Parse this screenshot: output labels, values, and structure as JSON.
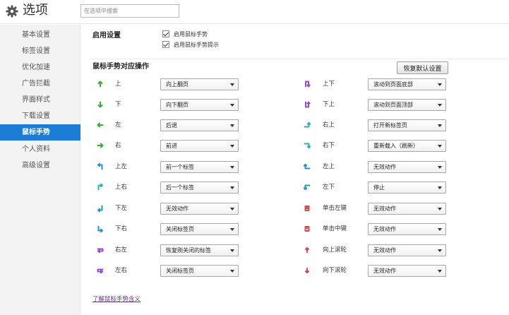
{
  "header": {
    "title": "选项",
    "search_placeholder": "在选项中搜索"
  },
  "sidebar": {
    "items": [
      {
        "label": "基本设置",
        "active": false
      },
      {
        "label": "标签设置",
        "active": false
      },
      {
        "label": "优化加速",
        "active": false
      },
      {
        "label": "广告拦截",
        "active": false
      },
      {
        "label": "界面样式",
        "active": false
      },
      {
        "label": "下载设置",
        "active": false
      },
      {
        "label": "鼠标手势",
        "active": true
      },
      {
        "label": "个人资料",
        "active": false
      },
      {
        "label": "高级设置",
        "active": false
      }
    ]
  },
  "enable": {
    "title": "启用设置",
    "options": [
      {
        "label": "启用鼠标手势",
        "checked": true
      },
      {
        "label": "启用鼠标手势提示",
        "checked": true
      }
    ]
  },
  "gestures": {
    "title": "鼠标手势对应操作",
    "reset_label": "恢复默认设置",
    "left": [
      {
        "label": "上",
        "action": "向上翻页",
        "icon": "arrow-up-icon",
        "color": "#3aaa3a"
      },
      {
        "label": "下",
        "action": "向下翻页",
        "icon": "arrow-down-icon",
        "color": "#3aaa3a"
      },
      {
        "label": "左",
        "action": "后退",
        "icon": "arrow-left-icon",
        "color": "#3aaa3a"
      },
      {
        "label": "右",
        "action": "前进",
        "icon": "arrow-right-icon",
        "color": "#3aaa3a"
      },
      {
        "label": "上左",
        "action": "前一个标签",
        "icon": "up-left-icon",
        "color": "#2c8fc8"
      },
      {
        "label": "上右",
        "action": "后一个标签",
        "icon": "up-right-icon",
        "color": "#2cb0b0"
      },
      {
        "label": "下左",
        "action": "无效动作",
        "icon": "down-left-icon",
        "color": "#2c8fc8"
      },
      {
        "label": "下右",
        "action": "关闭标签页",
        "icon": "down-right-icon",
        "color": "#2c8fc8"
      },
      {
        "label": "右左",
        "action": "恢复刚关闭的标签",
        "icon": "right-left-icon",
        "color": "#9a4cc6"
      },
      {
        "label": "左右",
        "action": "关闭标签页",
        "icon": "left-right-icon",
        "color": "#9a4cc6"
      }
    ],
    "right": [
      {
        "label": "上下",
        "action": "滚动到页面底部",
        "icon": "up-down-icon",
        "color": "#9a4cc6"
      },
      {
        "label": "下上",
        "action": "滚动到页面顶部",
        "icon": "down-up-icon",
        "color": "#9a4cc6"
      },
      {
        "label": "右上",
        "action": "打开新标签页",
        "icon": "right-up-icon",
        "color": "#2cb0b0"
      },
      {
        "label": "右下",
        "action": "重新载入（刷新）",
        "icon": "right-down-icon",
        "color": "#2cb0b0"
      },
      {
        "label": "左上",
        "action": "无效动作",
        "icon": "left-up-icon",
        "color": "#2c8fc8"
      },
      {
        "label": "左下",
        "action": "停止",
        "icon": "left-down-icon",
        "color": "#2c8fc8"
      },
      {
        "label": "单击左键",
        "action": "无效动作",
        "icon": "left-click-icon",
        "color": "#d04848"
      },
      {
        "label": "单击中键",
        "action": "无效动作",
        "icon": "middle-click-icon",
        "color": "#d04848"
      },
      {
        "label": "向上滚轮",
        "action": "无效动作",
        "icon": "wheel-up-icon",
        "color": "#d04848"
      },
      {
        "label": "向下滚轮",
        "action": "无效动作",
        "icon": "wheel-down-icon",
        "color": "#d04848"
      }
    ]
  },
  "help_link": "了解鼠标手势含义"
}
